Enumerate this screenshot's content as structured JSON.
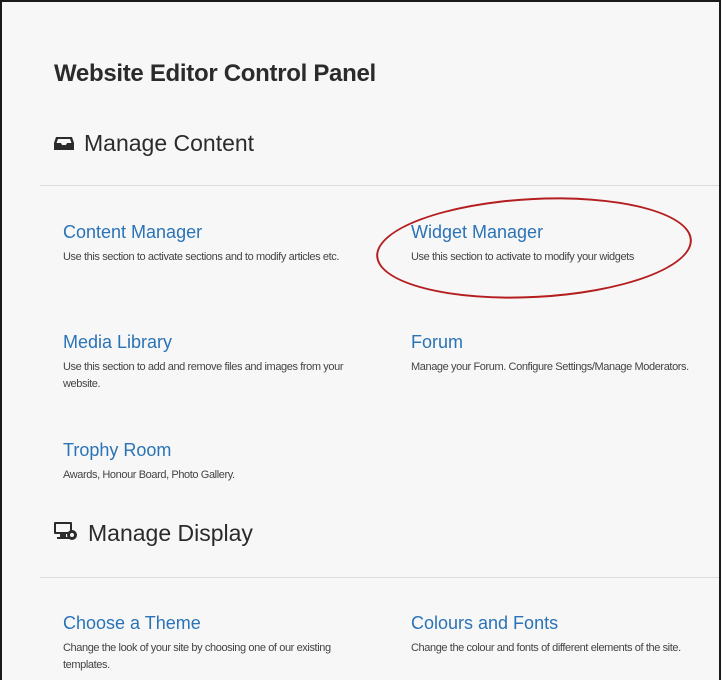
{
  "panel": {
    "title": "Website Editor Control Panel"
  },
  "sections": [
    {
      "heading": "Manage Content",
      "icon": "inbox-tray-icon",
      "items": [
        {
          "title": "Content Manager",
          "description": "Use this section to activate sections and to modify articles etc."
        },
        {
          "title": "Widget Manager",
          "description": "Use this section to activate to modify your widgets"
        },
        {
          "title": "Media Library",
          "description": "Use this section to add and remove files and images from your website."
        },
        {
          "title": "Forum",
          "description": "Manage your Forum. Configure Settings/Manage Moderators."
        },
        {
          "title": "Trophy Room",
          "description": "Awards, Honour Board, Photo Gallery."
        }
      ]
    },
    {
      "heading": "Manage Display",
      "icon": "monitor-settings-icon",
      "items": [
        {
          "title": "Choose a Theme",
          "description": "Change the look of your site by choosing one of our existing templates."
        },
        {
          "title": "Colours and Fonts",
          "description": "Change the colour and fonts of different elements of the site."
        }
      ]
    }
  ],
  "colors": {
    "link": "#2a73b6",
    "highlight": "#b51e1e",
    "text": "#2b2b2b"
  }
}
